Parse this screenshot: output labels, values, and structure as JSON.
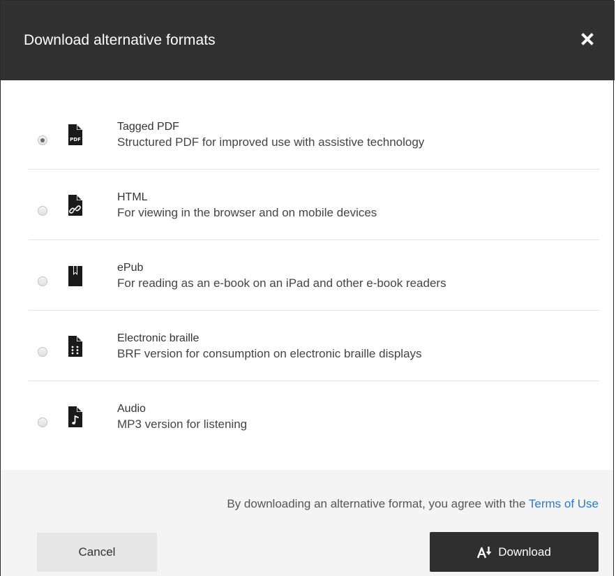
{
  "dialog": {
    "title": "Download alternative formats",
    "close_icon": "close-icon"
  },
  "formats": [
    {
      "name": "Tagged PDF",
      "description": "Structured PDF for improved use with assistive technology",
      "icon": "pdf-file-icon",
      "icon_text": "PDF",
      "selected": true
    },
    {
      "name": "HTML",
      "description": "For viewing in the browser and on mobile devices",
      "icon": "link-file-icon",
      "selected": false
    },
    {
      "name": "ePub",
      "description": "For reading as an e-book on an iPad and other e-book readers",
      "icon": "bookmark-icon",
      "selected": false
    },
    {
      "name": "Electronic braille",
      "description": "BRF version for consumption on electronic braille displays",
      "icon": "braille-file-icon",
      "selected": false
    },
    {
      "name": "Audio",
      "description": "MP3 version for listening",
      "icon": "audio-file-icon",
      "selected": false
    }
  ],
  "footer": {
    "terms_prefix": "By downloading an alternative format, you agree with the ",
    "terms_link": "Terms of Use",
    "cancel_label": "Cancel",
    "download_label": "Download",
    "download_icon": "accessible-download-icon"
  },
  "colors": {
    "header_bg": "#313131",
    "footer_bg": "#f4f4f4",
    "link": "#2f7abf",
    "download_bg": "#2f2f2f"
  }
}
